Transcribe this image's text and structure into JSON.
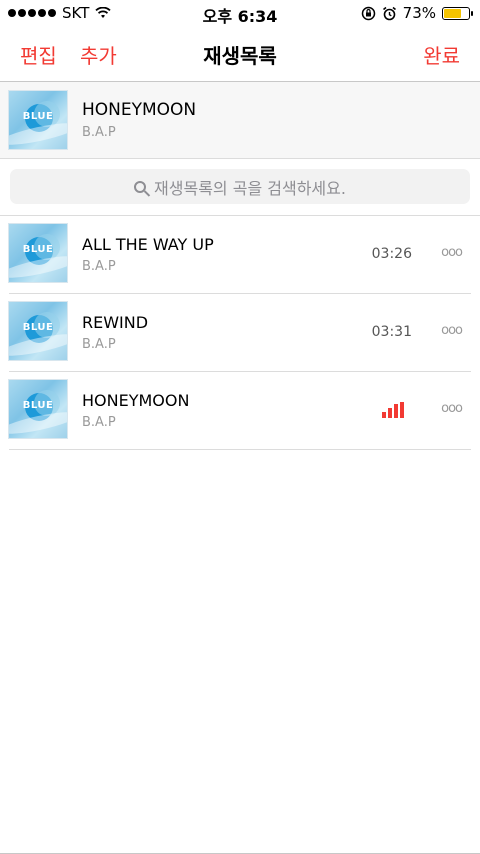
{
  "status_bar": {
    "carrier": "SKT",
    "time": "오후 6:34",
    "battery": "73%",
    "battery_level": 0.73
  },
  "nav": {
    "edit": "편집",
    "add": "추가",
    "title": "재생목록",
    "done": "완료"
  },
  "header": {
    "title": "HONEYMOON",
    "artist": "B.A.P",
    "art_text": "BLUE"
  },
  "search": {
    "placeholder": "재생목록의 곡을 검색하세요."
  },
  "tracks": [
    {
      "title": "ALL THE WAY UP",
      "artist": "B.A.P",
      "duration": "03:26",
      "more": "ooo",
      "art_text": "BLUE"
    },
    {
      "title": "REWIND",
      "artist": "B.A.P",
      "duration": "03:31",
      "more": "ooo",
      "art_text": "BLUE"
    },
    {
      "title": "HONEYMOON",
      "artist": "B.A.P",
      "duration": "",
      "playing": true,
      "more": "ooo",
      "art_text": "BLUE"
    }
  ],
  "colors": {
    "accent": "#f23a33",
    "secondary_text": "#9a9a9a",
    "battery": "#f5c400"
  },
  "icons": {
    "signal": "signal-dots-icon",
    "wifi": "wifi-icon",
    "rotation_lock": "rotation-lock-icon",
    "alarm": "alarm-icon",
    "search": "search-icon",
    "more": "more-icon",
    "now_playing": "equalizer-icon"
  }
}
